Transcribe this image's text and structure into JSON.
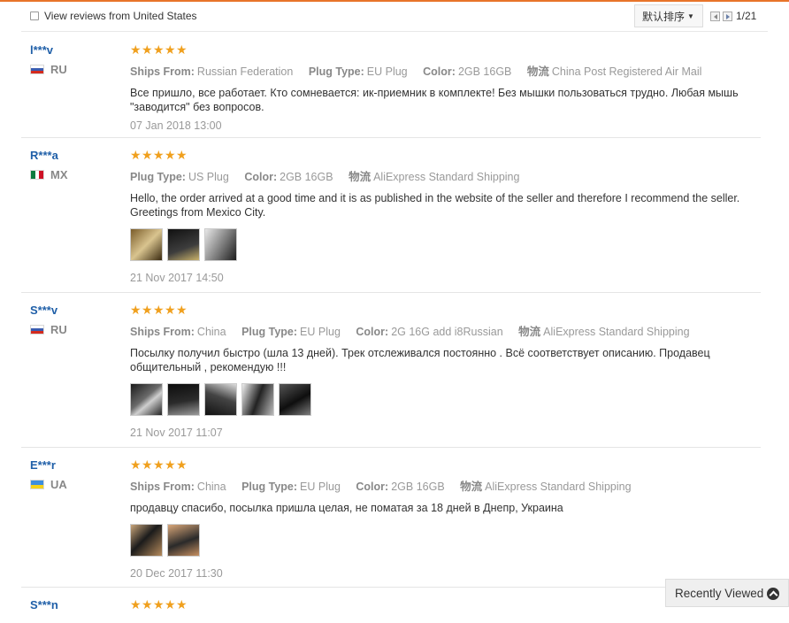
{
  "toolbar": {
    "filter_label": "View reviews from United States",
    "sort_label": "默认排序",
    "page_info": "1/21"
  },
  "labels": {
    "ships_from": "Ships From:",
    "plug_type": "Plug Type:",
    "color": "Color:",
    "logistics": "物流"
  },
  "reviews": [
    {
      "user": "l***v",
      "country": "RU",
      "ships_from": "Russian Federation",
      "plug_type": "EU Plug",
      "color": "2GB 16GB",
      "logistics": "China Post Registered Air Mail",
      "text": "Все пришло, все работает. Кто сомневается: ик-приемник в комплекте! Без мышки пользоваться трудно. Любая мышь \"заводится\" без вопросов.",
      "date": "07 Jan 2018 13:00",
      "photos": []
    },
    {
      "user": "R***a",
      "country": "MX",
      "plug_type": "US Plug",
      "color": "2GB 16GB",
      "logistics": "AliExpress Standard Shipping",
      "text": "Hello, the order arrived at a good time and it is as published in the website of the seller and therefore I recommend the seller. Greetings from Mexico City.",
      "date": "21 Nov 2017 14:50",
      "photos": [
        "photo-1",
        "photo-2",
        "photo-3"
      ]
    },
    {
      "user": "S***v",
      "country": "RU",
      "ships_from": "China",
      "plug_type": "EU Plug",
      "color": "2G 16G add i8Russian",
      "logistics": "AliExpress Standard Shipping",
      "text": "Посылку получил быстро (шла 13 дней). Трек отслеживался постоянно . Всё соответствует описанию. Продавец общительный , рекомендую !!!",
      "date": "21 Nov 2017 11:07",
      "photos": [
        "photo-1",
        "photo-2",
        "photo-3",
        "photo-4",
        "photo-5"
      ]
    },
    {
      "user": "E***r",
      "country": "UA",
      "ships_from": "China",
      "plug_type": "EU Plug",
      "color": "2GB 16GB",
      "logistics": "AliExpress Standard Shipping",
      "text": "продавцу спасибо, посылка пришла целая, не поматая за 18 дней в Днепр, Украина",
      "date": "20 Dec 2017 11:30",
      "photos": [
        "photo-1",
        "photo-2"
      ]
    },
    {
      "user": "S***n",
      "country": ""
    }
  ],
  "recently_viewed": "Recently Viewed",
  "colors": {
    "accent": "#e8742a",
    "username": "#1f5fa8",
    "star": "#f0a01e"
  }
}
